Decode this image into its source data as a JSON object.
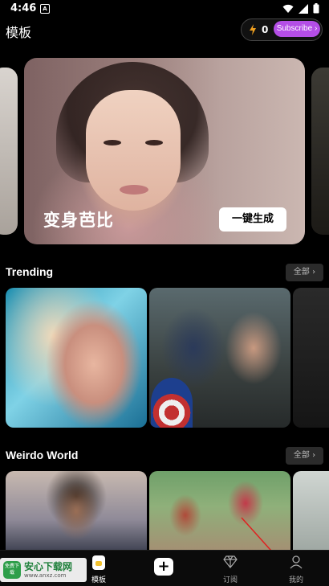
{
  "status_bar": {
    "time": "4:46",
    "notif_glyph": "A"
  },
  "header": {
    "title": "模板",
    "credits": "0",
    "subscribe_label": "Subscribe"
  },
  "banner": {
    "title": "变身芭比",
    "button_label": "一键生成"
  },
  "sections": [
    {
      "title": "Trending",
      "all_label": "全部"
    },
    {
      "title": "Weirdo World",
      "all_label": "全部"
    }
  ],
  "nav": {
    "items": [
      {
        "label": "模板",
        "active": true
      },
      {
        "label": "",
        "icon": "add-icon"
      },
      {
        "label": "订阅"
      },
      {
        "label": "我的"
      }
    ]
  },
  "watermark": {
    "badge": "免费下载",
    "name": "安心下载网",
    "url": "www.anxz.com"
  },
  "colors": {
    "accent": "#b44ee6",
    "background": "#000000"
  }
}
